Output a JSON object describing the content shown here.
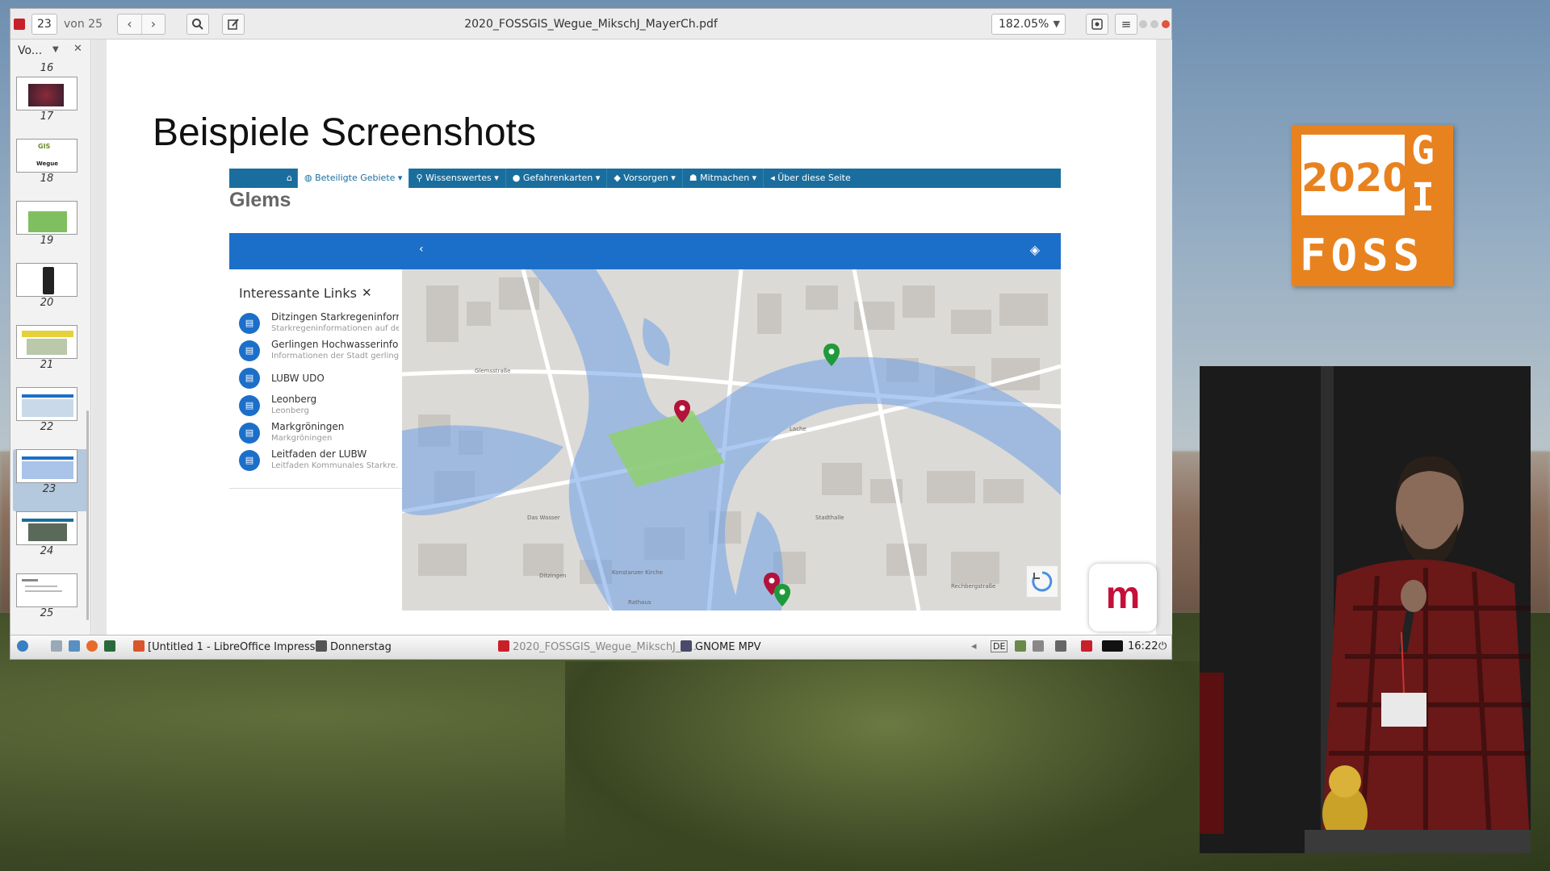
{
  "viewer": {
    "current_page": "23",
    "page_total": "von 25",
    "document_title": "2020_FOSSGIS_Wegue_MikschJ_MayerCh.pdf",
    "zoom": "182.05%"
  },
  "sidebar": {
    "view_label": "Vo...",
    "pages": [
      {
        "num": "16"
      },
      {
        "num": "17"
      },
      {
        "num": "18"
      },
      {
        "num": "19"
      },
      {
        "num": "20"
      },
      {
        "num": "21"
      },
      {
        "num": "22"
      },
      {
        "num": "23",
        "selected": true
      },
      {
        "num": "24"
      },
      {
        "num": "25"
      }
    ]
  },
  "slide": {
    "title": "Beispiele Screenshots",
    "web_nav": {
      "items": [
        {
          "label": "Beteiligte Gebiete",
          "active": true
        },
        {
          "label": "Wissenswertes"
        },
        {
          "label": "Gefahrenkarten"
        },
        {
          "label": "Vorsorgen"
        },
        {
          "label": "Mitmachen"
        },
        {
          "label": "Über diese Seite"
        }
      ]
    },
    "page_heading": "Glems",
    "links_panel": {
      "title": "Interessante Links",
      "items": [
        {
          "name": "Ditzingen Starkregeninform...",
          "sub": "Starkregeninformationen auf der..."
        },
        {
          "name": "Gerlingen Hochwasserinfor...",
          "sub": "Informationen der Stadt gerling..."
        },
        {
          "name": "LUBW UDO",
          "sub": ""
        },
        {
          "name": "Leonberg",
          "sub": "Leonberg"
        },
        {
          "name": "Markgröningen",
          "sub": "Markgröningen"
        },
        {
          "name": "Leitfaden der LUBW",
          "sub": "Leitfaden Kommunales Starkre..."
        }
      ]
    },
    "map_labels": [
      "Glemsstraße",
      "Ditzingen",
      "Konstanzer Kirche",
      "Rathaus",
      "Das Wasser",
      "Stadthalle",
      "Lache",
      "Rechbergstraße"
    ]
  },
  "taskbar": {
    "items": [
      {
        "label": "[Untitled 1 - LibreOffice Impress]"
      },
      {
        "label": "Donnerstag"
      },
      {
        "label": "2020_FOSSGIS_Wegue_MikschJ_M..."
      },
      {
        "label": "GNOME MPV"
      }
    ],
    "keyboard": "DE",
    "clock": "16:22"
  },
  "logo": {
    "year": "2020",
    "letters_right": [
      "G",
      "I"
    ],
    "bottom": "FOSS"
  },
  "colors": {
    "nav_bg": "#1a6e9e",
    "map_toolbar": "#1c6fc9",
    "fossgis_orange": "#e8821f",
    "m_logo_red": "#c4103a"
  }
}
